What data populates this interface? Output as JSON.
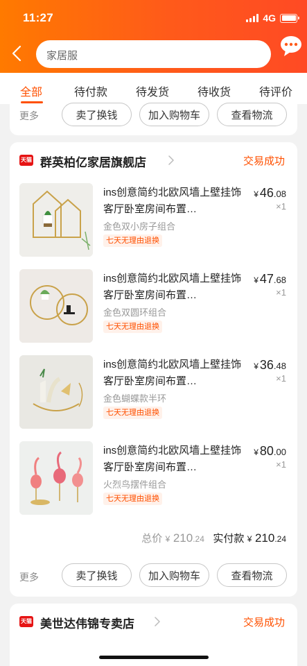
{
  "status_bar": {
    "time": "11:27",
    "network": "4G"
  },
  "search": {
    "value": "家居服"
  },
  "tabs": [
    {
      "label": "全部",
      "active": true
    },
    {
      "label": "待付款"
    },
    {
      "label": "待发货"
    },
    {
      "label": "待收货"
    },
    {
      "label": "待评价"
    }
  ],
  "prev_order": {
    "more_label": "更多",
    "actions": [
      "卖了换钱",
      "加入购物车",
      "查看物流"
    ]
  },
  "order": {
    "store_badge": "天猫",
    "store_name": "群英柏亿家居旗舰店",
    "status": "交易成功",
    "items": [
      {
        "title": "ins创意简约北欧风墙上壁挂饰客厅卧室房间布置…",
        "sku": "金色双小房子组合",
        "tag": "七天无理由退换",
        "price_symbol": "¥",
        "price_int": "46",
        "price_dec": ".08",
        "qty": "×1"
      },
      {
        "title": "ins创意简约北欧风墙上壁挂饰客厅卧室房间布置…",
        "sku": "金色双圆环组合",
        "tag": "七天无理由退换",
        "price_symbol": "¥",
        "price_int": "47",
        "price_dec": ".68",
        "qty": "×1"
      },
      {
        "title": "ins创意简约北欧风墙上壁挂饰客厅卧室房间布置…",
        "sku": "金色蝴蝶款半环",
        "tag": "七天无理由退换",
        "price_symbol": "¥",
        "price_int": "36",
        "price_dec": ".48",
        "qty": "×1"
      },
      {
        "title": "ins创意简约北欧风墙上壁挂饰客厅卧室房间布置…",
        "sku": "火烈鸟摆件组合",
        "tag": "七天无理由退换",
        "price_symbol": "¥",
        "price_int": "80",
        "price_dec": ".00",
        "qty": "×1"
      }
    ],
    "total_label": "总价",
    "total_symbol": "¥",
    "total_int": "210",
    "total_dec": ".24",
    "paid_label": "实付款",
    "paid_symbol": "¥",
    "paid_int": "210",
    "paid_dec": ".24",
    "more_label": "更多",
    "actions": [
      "卖了换钱",
      "加入购物车",
      "查看物流"
    ]
  },
  "next_order": {
    "store_badge": "天猫",
    "store_name": "美世达伟锦专卖店",
    "status": "交易成功"
  },
  "colors": {
    "accent": "#ff5000",
    "header_start": "#ff7a00",
    "header_end": "#ff4a24",
    "tmall_red": "#e61414"
  }
}
